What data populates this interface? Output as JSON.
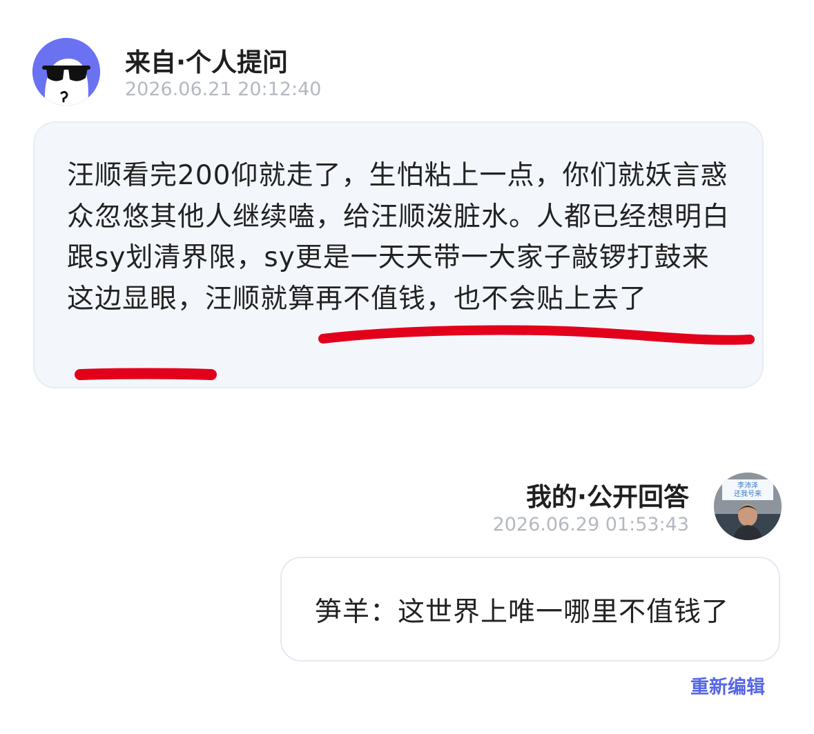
{
  "question": {
    "title": "来自·个人提问",
    "time": "2026.06.21 20:12:40",
    "avatar_icon": "sunglasses-ghost-icon",
    "avatar_color": "#6b72f2",
    "text": "汪顺看完200仰就走了，生怕粘上一点，你们就妖言惑众忽悠其他人继续嗑，给汪顺泼脏水。人都已经想明白跟sy划清界限，sy更是一天天带一大家子敲锣打鼓来这边显眼，汪顺就算再不值钱，也不会贴上去了"
  },
  "answer": {
    "title": "我的·公开回答",
    "time": "2026.06.29 01:53:43",
    "avatar_sign_text": "李沛泽\n还我号来",
    "text": "笋羊：这世界上唯一哪里不值钱了",
    "edit_label": "重新编辑"
  },
  "colors": {
    "accent": "#5566e6",
    "underline": "#e3001b",
    "timestamp": "#b4b8c0"
  }
}
